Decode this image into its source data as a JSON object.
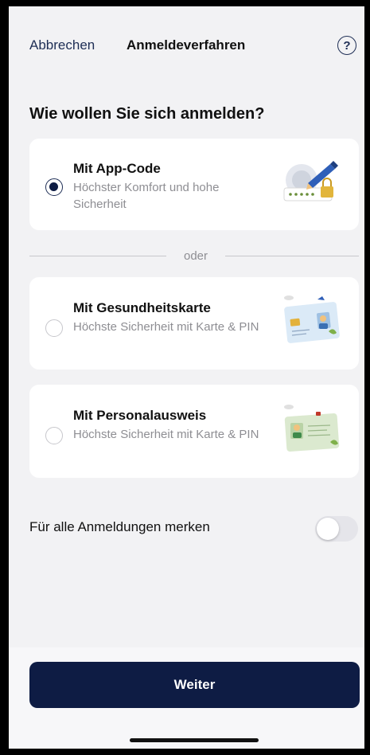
{
  "header": {
    "cancel_label": "Abbrechen",
    "title": "Anmeldeverfahren",
    "help_symbol": "?"
  },
  "question": "Wie wollen Sie sich anmelden?",
  "options": [
    {
      "title": "Mit App-Code",
      "subtitle": "Höchster Komfort und hohe Sicherheit",
      "selected": true,
      "icon": "app-code-illustration"
    },
    {
      "title": "Mit Gesundheitskarte",
      "subtitle": "Höchste Sicherheit mit Karte & PIN",
      "selected": false,
      "icon": "health-card-illustration"
    },
    {
      "title": "Mit Personalausweis",
      "subtitle": "Höchste Sicherheit mit Karte & PIN",
      "selected": false,
      "icon": "id-card-illustration"
    }
  ],
  "divider_label": "oder",
  "remember": {
    "label": "Für alle Anmeldungen merken",
    "enabled": false
  },
  "continue_label": "Weiter",
  "colors": {
    "primary": "#0e1c44",
    "link": "#1e2e55",
    "background": "#f2f2f4"
  }
}
